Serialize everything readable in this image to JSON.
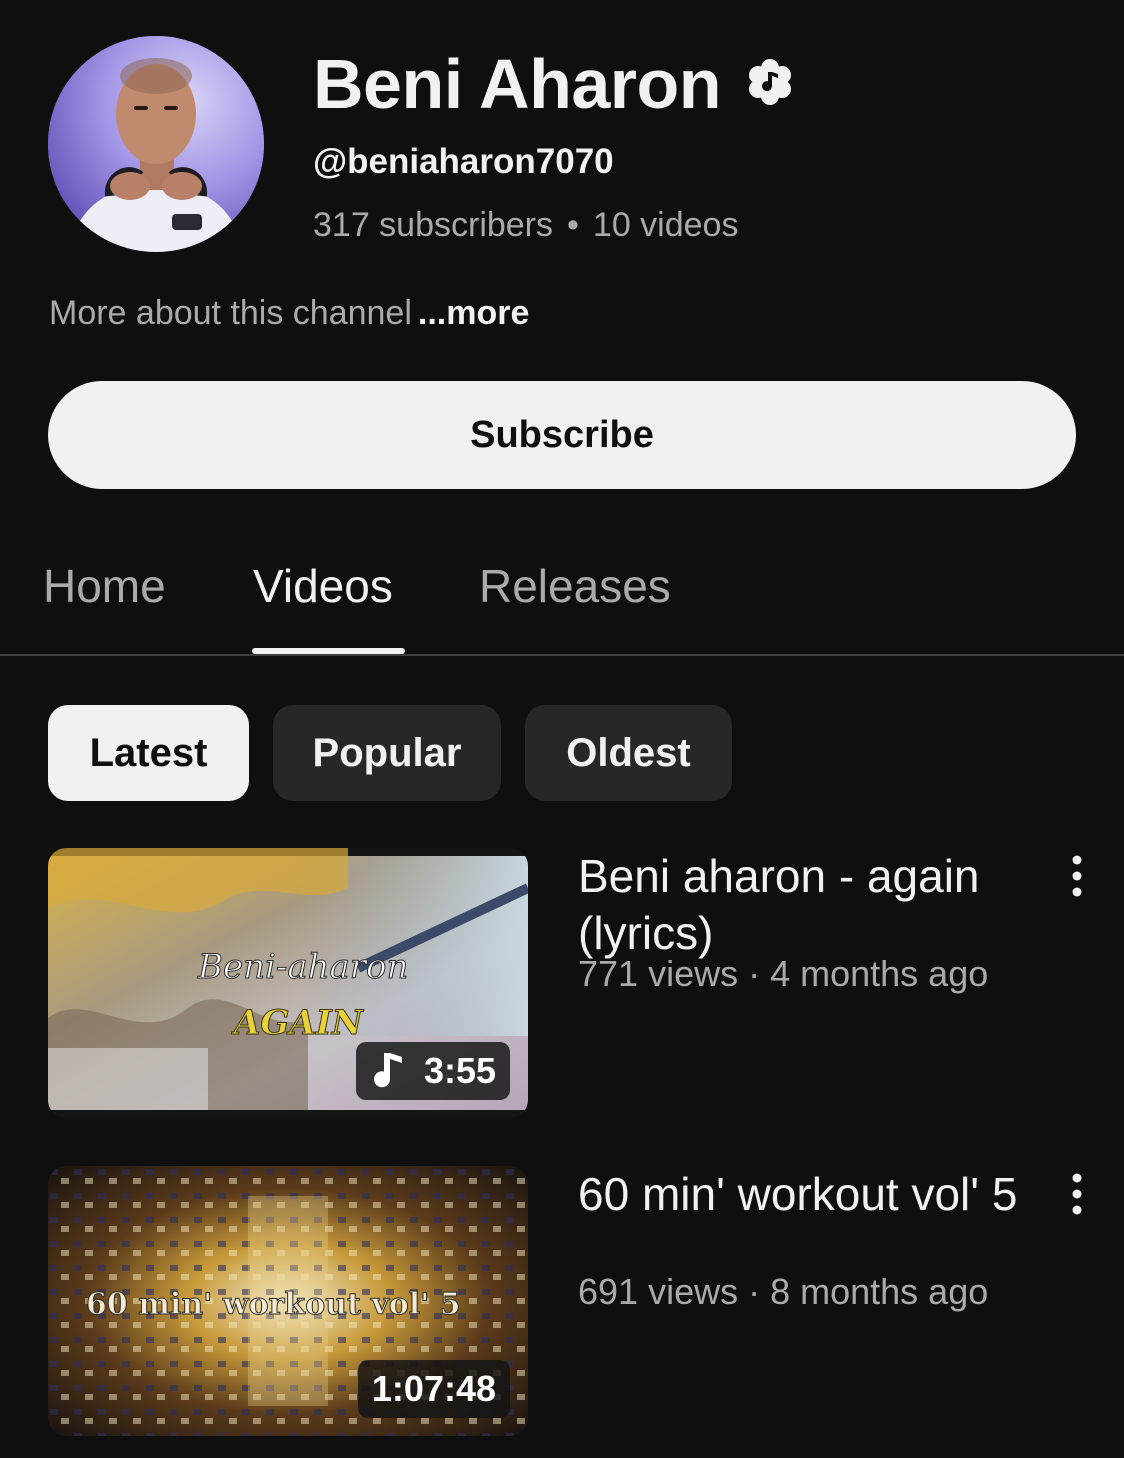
{
  "channel": {
    "name": "Beni Aharon",
    "handle": "@beniaharon7070",
    "subscribers": "317 subscribers",
    "stats_separator": "•",
    "videos_count": "10 videos",
    "about": "More about this channel",
    "more_label": "...more",
    "avatar_icon": "avatar-photo",
    "verified_icon": "verified-music-badge-icon"
  },
  "subscribe": {
    "label": "Subscribe"
  },
  "tabs": [
    {
      "label": "Home",
      "active": false
    },
    {
      "label": "Videos",
      "active": true
    },
    {
      "label": "Releases",
      "active": false
    }
  ],
  "chips": [
    {
      "label": "Latest",
      "selected": true
    },
    {
      "label": "Popular",
      "selected": false
    },
    {
      "label": "Oldest",
      "selected": false
    }
  ],
  "videos": [
    {
      "title": "Beni aharon - again (lyrics)",
      "views": "771 views",
      "separator": "·",
      "age": "4 months ago",
      "duration": "3:55",
      "thumbnail_text_line1": "Beni-aharon",
      "thumbnail_text_line2": "AGAIN",
      "duration_icon": "music-note-icon"
    },
    {
      "title": "60 min' workout vol' 5",
      "views": "691 views",
      "separator": "·",
      "age": "8 months ago",
      "duration": "1:07:48",
      "thumbnail_text_line1": "60 min' workout vol' 5"
    }
  ],
  "colors": {
    "background": "#0f0f0f",
    "primary_text": "#f1f1f1",
    "secondary_text": "#aaaaaa",
    "chip_background": "#272727",
    "button_background": "#f1f1f1"
  }
}
